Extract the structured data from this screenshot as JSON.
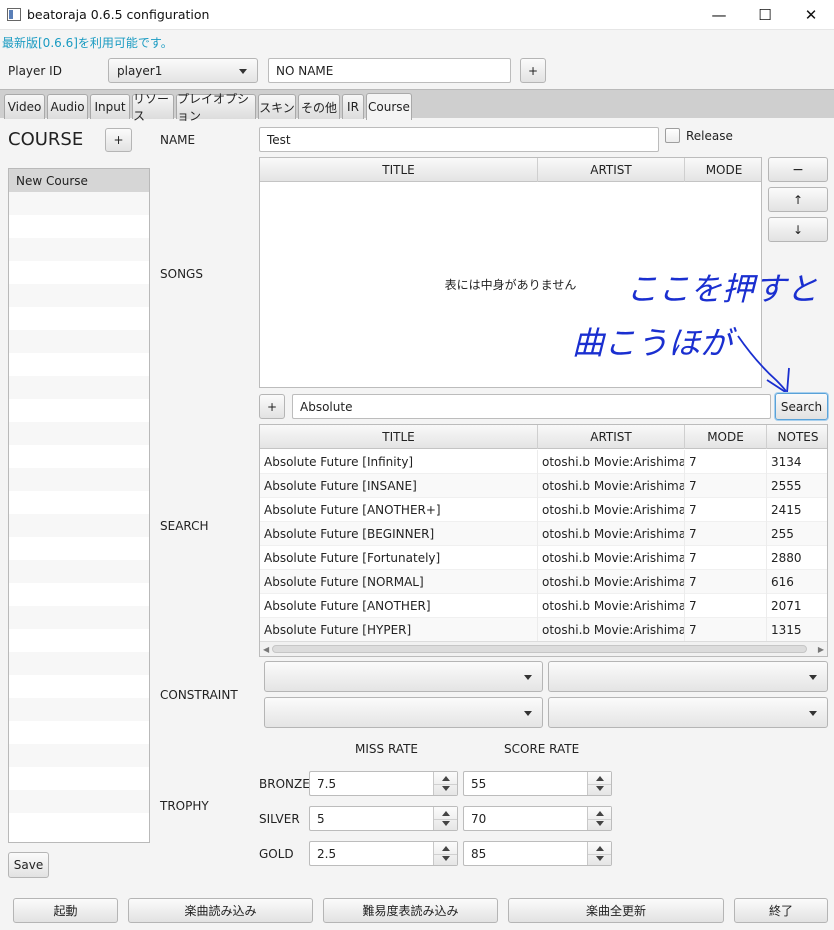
{
  "window": {
    "title": "beatoraja 0.6.5 configuration"
  },
  "notice": "最新版[0.6.6]を利用可能です。",
  "player": {
    "label": "Player ID",
    "selected": "player1",
    "name": "NO NAME",
    "add_label": "+"
  },
  "tabs": [
    {
      "label": "Video"
    },
    {
      "label": "Audio"
    },
    {
      "label": "Input"
    },
    {
      "label": "リソース"
    },
    {
      "label": "プレイオプション"
    },
    {
      "label": "スキン"
    },
    {
      "label": "その他"
    },
    {
      "label": "IR"
    },
    {
      "label": "Course"
    }
  ],
  "course": {
    "heading": "COURSE",
    "add_label": "+",
    "list": [
      "New Course"
    ],
    "save_label": "Save"
  },
  "name_section": {
    "label": "NAME",
    "value": "Test",
    "release_label": "Release"
  },
  "songs": {
    "label": "SONGS",
    "columns": [
      "TITLE",
      "ARTIST",
      "MODE"
    ],
    "empty_text": "表には中身がありません",
    "remove_label": "−",
    "up_label": "↑",
    "down_label": "↓"
  },
  "search": {
    "label": "SEARCH",
    "add_label": "+",
    "query": "Absolute",
    "button_label": "Search",
    "columns": [
      "TITLE",
      "ARTIST",
      "MODE",
      "NOTES"
    ],
    "rows": [
      {
        "title": "Absolute Future [Infinity]",
        "artist": "otoshi.b Movie:Arishima...",
        "mode": "7",
        "notes": "3134"
      },
      {
        "title": "Absolute Future [INSANE]",
        "artist": "otoshi.b Movie:Arishima...",
        "mode": "7",
        "notes": "2555"
      },
      {
        "title": "Absolute Future [ANOTHER+]",
        "artist": "otoshi.b Movie:Arishima...",
        "mode": "7",
        "notes": "2415"
      },
      {
        "title": "Absolute Future [BEGINNER]",
        "artist": "otoshi.b Movie:Arishima...",
        "mode": "7",
        "notes": "255"
      },
      {
        "title": "Absolute Future [Fortunately]",
        "artist": "otoshi.b Movie:Arishima...",
        "mode": "7",
        "notes": "2880"
      },
      {
        "title": "Absolute Future [NORMAL]",
        "artist": "otoshi.b Movie:Arishima...",
        "mode": "7",
        "notes": "616"
      },
      {
        "title": "Absolute Future [ANOTHER]",
        "artist": "otoshi.b Movie:Arishima...",
        "mode": "7",
        "notes": "2071"
      },
      {
        "title": "Absolute Future [HYPER]",
        "artist": "otoshi.b Movie:Arishima...",
        "mode": "7",
        "notes": "1315"
      }
    ]
  },
  "constraint": {
    "label": "CONSTRAINT"
  },
  "trophy": {
    "label": "TROPHY",
    "miss_rate_header": "MISS RATE",
    "score_rate_header": "SCORE RATE",
    "rows": [
      {
        "name": "BRONZE",
        "miss": "7.5",
        "score": "55"
      },
      {
        "name": "SILVER",
        "miss": "5",
        "score": "70"
      },
      {
        "name": "GOLD",
        "miss": "2.5",
        "score": "85"
      }
    ]
  },
  "annotation": {
    "line1": "ここを押すと",
    "line2": "曲こうほが"
  },
  "bottom_buttons": [
    "起動",
    "楽曲読み込み",
    "難易度表読み込み",
    "楽曲全更新",
    "終了"
  ],
  "colors": {
    "notice": "#1a9bc2",
    "annotation_ink": "#1a2fd0",
    "focus": "#5aa2d8"
  }
}
